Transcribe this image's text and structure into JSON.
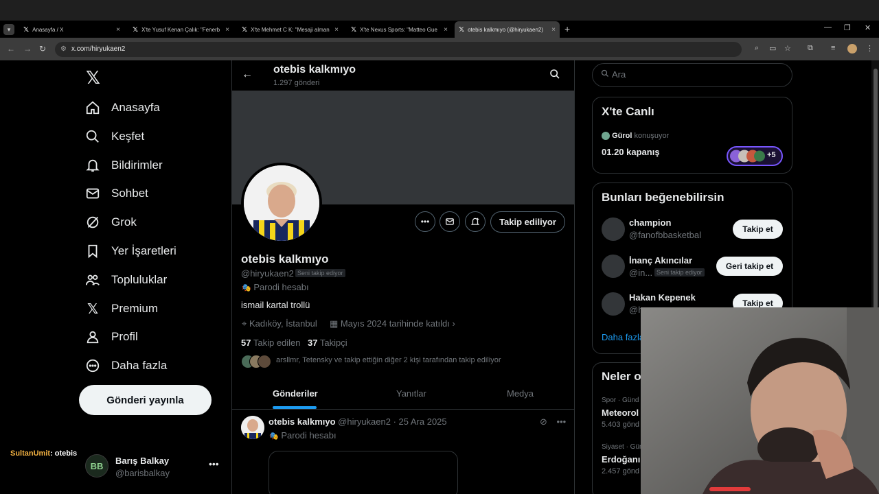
{
  "browser": {
    "tabs": [
      {
        "title": "Anasayfa / X"
      },
      {
        "title": "X'te Yusuf Kenan Çalık: \"Fenerb"
      },
      {
        "title": "X'te Mehmet C K: \"Mesaji alman"
      },
      {
        "title": "X'te Nexus Sports: \"Matteo Gue"
      },
      {
        "title": "otebis kalkmıyo (@hiryukaen2)"
      }
    ],
    "url": "x.com/hiryukaen2"
  },
  "nav": {
    "items": [
      {
        "label": "Anasayfa"
      },
      {
        "label": "Keşfet"
      },
      {
        "label": "Bildirimler"
      },
      {
        "label": "Sohbet"
      },
      {
        "label": "Grok"
      },
      {
        "label": "Yer İşaretleri"
      },
      {
        "label": "Topluluklar"
      },
      {
        "label": "Premium"
      },
      {
        "label": "Profil"
      },
      {
        "label": "Daha fazla"
      }
    ],
    "post_button": "Gönderi yayınla",
    "account": {
      "name": "Barış Balkay",
      "handle": "@barisbalkay"
    }
  },
  "stream_overlay": {
    "user": "SultanUmit",
    "message": ": otebis"
  },
  "profile": {
    "header_name": "otebis kalkmıyo",
    "post_count": "1.297 gönderi",
    "name": "otebis kalkmıyo",
    "handle": "@hiryukaen2",
    "follows_you": "Seni takip ediyor",
    "parody": "Parodi hesabı",
    "bio": "ismail kartal trollü",
    "location": "Kadıköy, İstanbul",
    "joined": "Mayıs 2024 tarihinde katıldı",
    "following_count": "57",
    "following_label": "Takip edilen",
    "followers_count": "37",
    "followers_label": "Takipçi",
    "mutuals": "arsllmr, Tetensky ve takip ettiğin diğer 2 kişi tarafından takip ediliyor",
    "follow_button": "Takip ediliyor",
    "tabs": [
      {
        "label": "Gönderiler"
      },
      {
        "label": "Yanıtlar"
      },
      {
        "label": "Medya"
      }
    ]
  },
  "post": {
    "name": "otebis kalkmıyo",
    "handle_date": "@hiryukaen2 · 25 Ara 2025",
    "parody": "Parodi hesabı"
  },
  "right": {
    "search_placeholder": "Ara",
    "live": {
      "title": "X'te Canlı",
      "host": "Gürol",
      "host_status": "konuşuyor",
      "space_title": "01.20 kapanış",
      "extra": "+5"
    },
    "suggestions": {
      "title": "Bunları beğenebilirsin",
      "items": [
        {
          "name": "champion",
          "handle": "@fanofbbasketbal",
          "button": "Takip et"
        },
        {
          "name": "İnanç Akıncılar",
          "handle": "@in...",
          "badge": "Seni takip ediyor",
          "button": "Geri takip et"
        },
        {
          "name": "Hakan Kepenek",
          "handle": "@h",
          "button": "Takip et"
        }
      ],
      "more": "Daha fazla"
    },
    "trends": {
      "title": "Neler o",
      "items": [
        {
          "category": "Spor · Günd",
          "name": "Meteorol",
          "count": "5.403 gönd"
        },
        {
          "category": "Siyaset · Gün",
          "name": "Erdoğanı",
          "count": "2.457 gönd"
        }
      ]
    }
  },
  "colors": {
    "accent": "#1d9bf0",
    "background": "#000000",
    "border": "#2f3336",
    "secondary_text": "#71767b"
  }
}
